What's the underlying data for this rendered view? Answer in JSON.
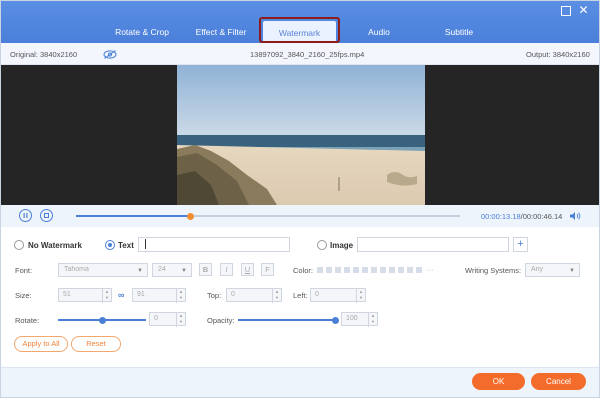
{
  "tabs": [
    {
      "label": "Rotate & Crop"
    },
    {
      "label": "Effect & Filter"
    },
    {
      "label": "Watermark"
    },
    {
      "label": "Audio"
    },
    {
      "label": "Subtitle"
    }
  ],
  "active_tab": "Watermark",
  "info": {
    "original": "Original: 3840x2160",
    "filename": "13897092_3840_2160_25fps.mp4",
    "output": "Output: 3840x2160"
  },
  "playback": {
    "current": "00:00:13.18",
    "total": "/00:00:46.14",
    "progress": 0.298
  },
  "watermark": {
    "no_watermark_label": "No Watermark",
    "text_label": "Text",
    "text_value": "",
    "image_label": "Image",
    "image_value": "",
    "selected": "Text"
  },
  "font": {
    "label": "Font:",
    "family": "Tahoma",
    "size": "24",
    "bold": "B",
    "italic": "I",
    "underline": "U",
    "strike": "F"
  },
  "color": {
    "label": "Color:",
    "more": "···"
  },
  "writing": {
    "label": "Writing Systems:",
    "value": "Any"
  },
  "size": {
    "label": "Size:",
    "width": "51",
    "height": "91"
  },
  "top": {
    "label": "Top:",
    "value": "0"
  },
  "left": {
    "label": "Left:",
    "value": "0"
  },
  "rotate": {
    "label": "Rotate:",
    "value": "0",
    "level": 0.5
  },
  "opacity": {
    "label": "Opacity:",
    "value": "100",
    "level": 1.0
  },
  "buttons": {
    "apply_all": "Apply to All",
    "reset": "Reset",
    "ok": "OK",
    "cancel": "Cancel"
  },
  "colors": {
    "accent": "#4a7fd8",
    "orange": "#f36c2b",
    "header": "#5a8fe4"
  }
}
